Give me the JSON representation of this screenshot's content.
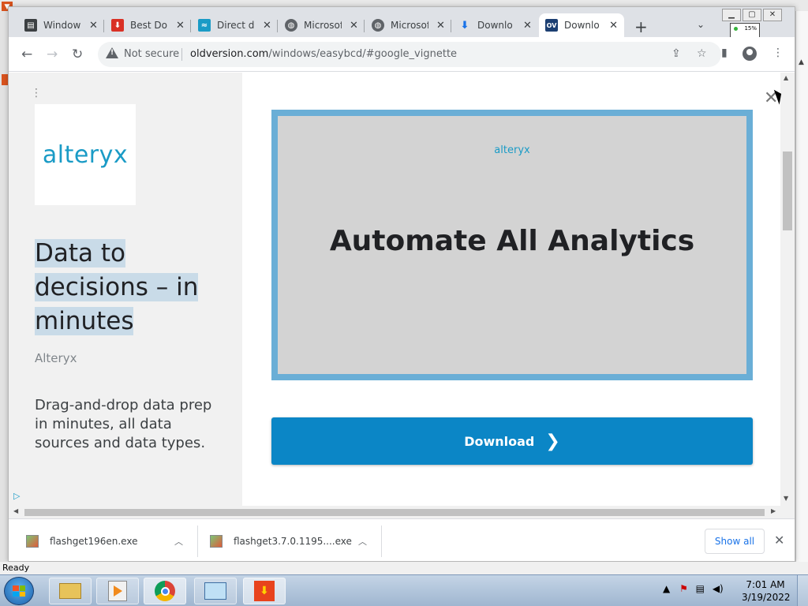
{
  "chrome": {
    "tabs": [
      {
        "label": "Windows",
        "icon": "document-icon",
        "color": "#3c4043"
      },
      {
        "label": "Best Do",
        "icon": "download-badge-icon",
        "color": "#d93025"
      },
      {
        "label": "Direct d",
        "icon": "wave-icon",
        "color": "#1a9bc6"
      },
      {
        "label": "Microsof",
        "icon": "globe-icon",
        "color": "#5f6368"
      },
      {
        "label": "Microsof",
        "icon": "globe-icon",
        "color": "#5f6368"
      },
      {
        "label": "Downlo",
        "icon": "download-arrow-icon",
        "color": "#1a73e8"
      },
      {
        "label": "Downlo",
        "icon": "ov-logo-icon",
        "color": "#1c3f72",
        "icon_text": "OV",
        "active": true
      }
    ],
    "new_tab_symbol": "+",
    "tab_search_symbol": "⌄",
    "mini_overlay_text": "15%",
    "address": {
      "security_label": "Not secure",
      "host": "oldversion.com",
      "path": "/windows/easybcd/#google_vignette"
    }
  },
  "ad": {
    "brand_logo": "alteryx",
    "headline": "Data to decisions – in minutes",
    "advertiser": "Alteryx",
    "description": "Drag-and-drop data prep in minutes, all data sources and data types.",
    "creative_logo": "alteryx",
    "creative_headline": "Automate All Analytics",
    "cta_label": "Download",
    "cta_chevron": "❯",
    "close_symbol": "✕",
    "adchoices_symbol": "▷",
    "accent_color": "#0b86c6"
  },
  "downloads": {
    "items": [
      {
        "filename": "flashget196en.exe"
      },
      {
        "filename": "flashget3.7.0.1195....exe"
      }
    ],
    "show_all_label": "Show all",
    "close_symbol": "✕"
  },
  "status_bar": {
    "text": "Ready"
  },
  "taskbar": {
    "clock_time": "7:01 AM",
    "clock_date": "3/19/2022"
  }
}
